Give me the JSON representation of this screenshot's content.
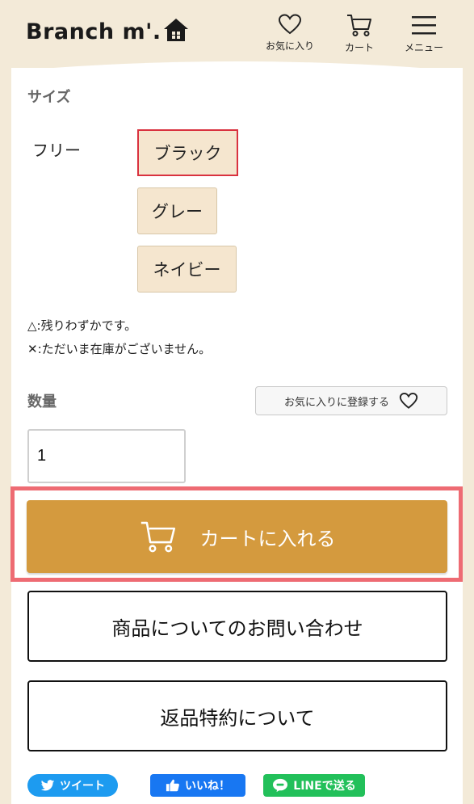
{
  "header": {
    "logo": "Branch m'.",
    "nav": {
      "favorites": "お気に入り",
      "cart": "カート",
      "menu": "メニュー"
    }
  },
  "product": {
    "size_label": "サイズ",
    "size_name": "フリー",
    "color_options": [
      {
        "label": "ブラック",
        "selected": true
      },
      {
        "label": "グレー",
        "selected": false
      },
      {
        "label": "ネイビー",
        "selected": false
      }
    ],
    "notes": {
      "few_left": "△:残りわずかです。",
      "out_of_stock": "✕:ただいま在庫がございません。"
    },
    "quantity_label": "数量",
    "quantity_value": "1",
    "add_favorite_label": "お気に入りに登録する"
  },
  "actions": {
    "add_to_cart": "カートに入れる",
    "inquiry": "商品についてのお問い合わせ",
    "return_policy": "返品特約について"
  },
  "share": {
    "tweet": "ツイート",
    "like": "いいね！",
    "line": "LINEで送る"
  },
  "colors": {
    "header_bg": "#f3ead8",
    "option_bg": "#f5e6cf",
    "selected_border": "#d9323f",
    "cart_button": "#d49a3e",
    "highlight_frame": "#ee6b73",
    "twitter": "#1d9bf0",
    "facebook": "#1877f2",
    "line": "#22c05a"
  }
}
